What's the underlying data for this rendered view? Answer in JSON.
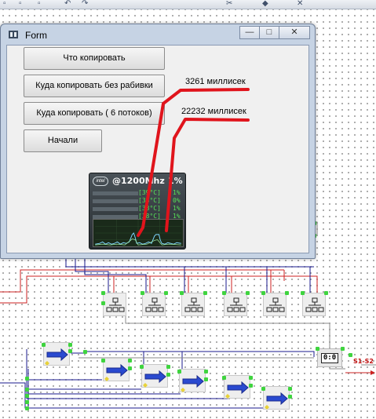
{
  "window": {
    "title": "Form",
    "controls": {
      "minimize": "—",
      "maximize": "□",
      "close": "✕"
    }
  },
  "buttons": {
    "what_to_copy": "Что копировать",
    "where_no_split": "Куда копировать без рабивки",
    "where_6_threads": "Куда копировать ( 6 потоков)",
    "start": "Начали"
  },
  "labels": {
    "time_no_split": "3261 миллисек",
    "time_6_threads": "22232 миллисек"
  },
  "cpu_meter": {
    "logo": "intel",
    "header": "@1200Mhz",
    "total_percent": "1%",
    "cores": [
      {
        "temp": "[39°C]",
        "percent": "1%"
      },
      {
        "temp": "[38°C]",
        "percent": "0%"
      },
      {
        "temp": "[38°C]",
        "percent": "1%"
      },
      {
        "temp": "[38°C]",
        "percent": "1%"
      }
    ]
  },
  "diagram": {
    "timer_display": "0:0",
    "signal_label": "S1-S2"
  },
  "colors": {
    "annotation_red": "#e0141c",
    "pin_green": "#3fd43f",
    "wire_red": "#cc2020",
    "wire_blue": "#1a1a8c",
    "window_frame": "#c6d3e4"
  }
}
